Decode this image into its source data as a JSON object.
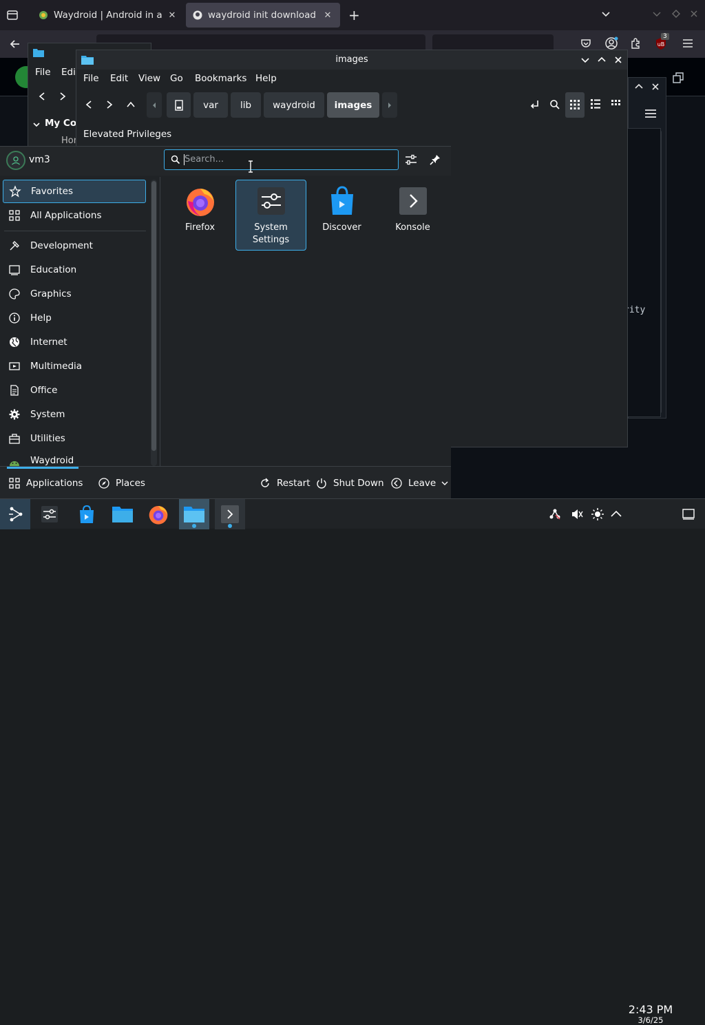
{
  "colors": {
    "accent": "#3daee9",
    "panel": "#202326",
    "selection": "#2c4152"
  },
  "browser": {
    "tabs": [
      {
        "title": "Waydroid | Android in a Li",
        "icon": "waydroid-favicon"
      },
      {
        "title": "waydroid init download ge",
        "icon": "github-favicon"
      }
    ],
    "extension_badge": "3"
  },
  "github": {
    "code_fragment": "rity",
    "status_fragment": "3"
  },
  "dolphin_back": {
    "menu_file": "File",
    "menu_edit": "Edit",
    "tree_item": "My Cor",
    "tree_sub": "Hom"
  },
  "dolphin": {
    "title": "images",
    "menu": [
      "File",
      "Edit",
      "View",
      "Go",
      "Bookmarks",
      "Help"
    ],
    "breadcrumbs": [
      "var",
      "lib",
      "waydroid",
      "images"
    ],
    "banner": "Elevated Privileges"
  },
  "kickoff": {
    "user": "vm3",
    "search_placeholder": "Search...",
    "categories": [
      {
        "label": "Favorites",
        "icon": "star-icon"
      },
      {
        "label": "All Applications",
        "icon": "grid-icon"
      },
      {
        "label": "Development",
        "icon": "hammer-icon"
      },
      {
        "label": "Education",
        "icon": "education-icon"
      },
      {
        "label": "Graphics",
        "icon": "palette-icon"
      },
      {
        "label": "Help",
        "icon": "info-icon"
      },
      {
        "label": "Internet",
        "icon": "globe-icon"
      },
      {
        "label": "Multimedia",
        "icon": "multimedia-icon"
      },
      {
        "label": "Office",
        "icon": "document-icon"
      },
      {
        "label": "System",
        "icon": "gear-icon"
      },
      {
        "label": "Utilities",
        "icon": "toolbox-icon"
      },
      {
        "label": "Waydroid",
        "icon": "waydroid-icon"
      }
    ],
    "apps": [
      {
        "label": "Firefox",
        "icon": "firefox-icon"
      },
      {
        "label": "System Settings",
        "icon": "system-settings-icon"
      },
      {
        "label": "Discover",
        "icon": "discover-icon"
      },
      {
        "label": "Konsole",
        "icon": "konsole-icon"
      }
    ],
    "footer": {
      "applications": "Applications",
      "places": "Places",
      "restart": "Restart",
      "shutdown": "Shut Down",
      "leave": "Leave"
    }
  },
  "taskbar": {
    "time": "2:43 PM",
    "date": "3/6/25"
  }
}
